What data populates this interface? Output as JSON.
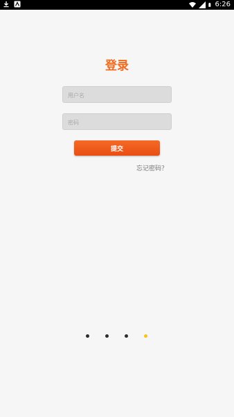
{
  "status_bar": {
    "time": "6:26",
    "icons": [
      "download-icon",
      "app-icon",
      "wifi-icon",
      "signal-icon",
      "battery-icon"
    ]
  },
  "login": {
    "title": "登录",
    "username_placeholder": "用户名",
    "password_placeholder": "密码",
    "username_value": "",
    "password_value": "",
    "submit_label": "提交",
    "forgot_link": "忘记密码？"
  },
  "pager": {
    "count": 4,
    "active_index": 3,
    "active_color": "#f5c518",
    "inactive_color": "#2d2d2d"
  },
  "colors": {
    "accent": "#f26a1b",
    "background": "#f6f6f6"
  }
}
